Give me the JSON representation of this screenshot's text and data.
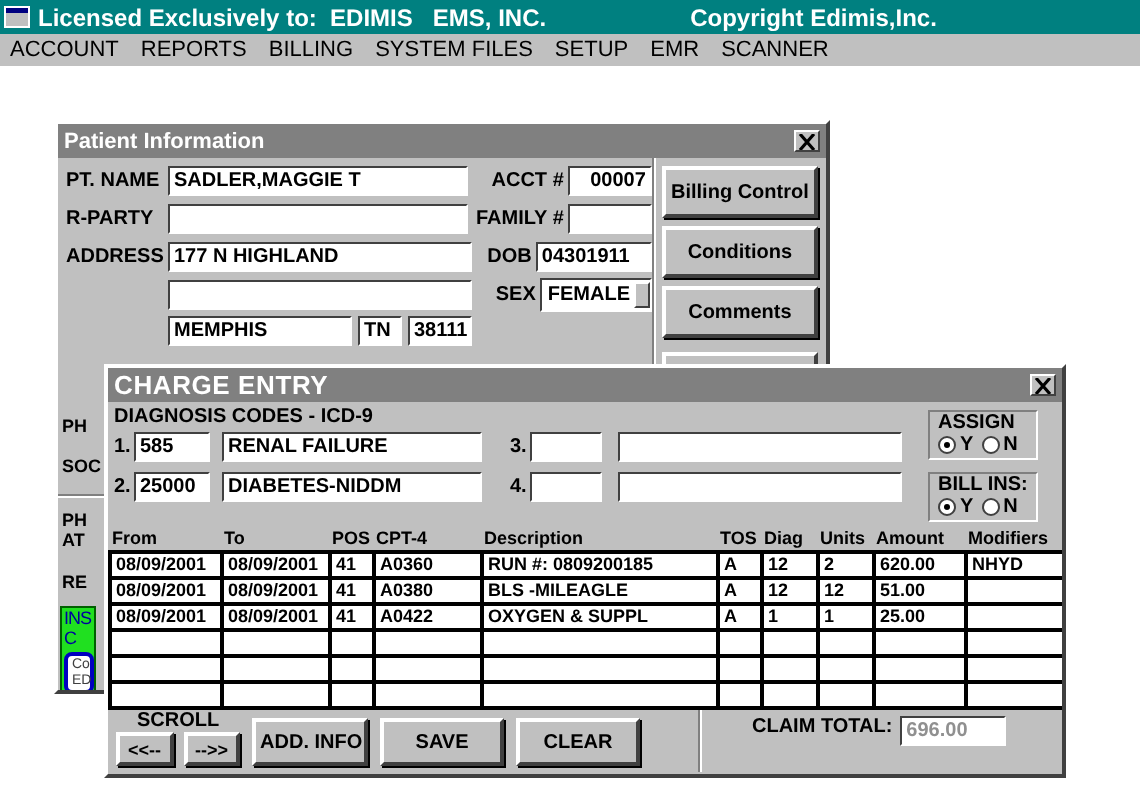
{
  "app_bar": {
    "title": "Licensed Exclusively to:  EDIMIS   EMS, INC.",
    "copyright": "Copyright Edimis,Inc."
  },
  "menu": [
    {
      "label": "ACCOUNT"
    },
    {
      "label": "REPORTS"
    },
    {
      "label": "BILLING"
    },
    {
      "label": "SYSTEM FILES"
    },
    {
      "label": "SETUP"
    },
    {
      "label": "EMR"
    },
    {
      "label": "SCANNER"
    }
  ],
  "patient_window": {
    "title": "Patient Information",
    "pt_name": {
      "label": "PT. NAME",
      "value": "SADLER,MAGGIE T"
    },
    "acct": {
      "label": "ACCT #",
      "value": "00007"
    },
    "r_party": {
      "label": "R-PARTY"
    },
    "family": {
      "label": "FAMILY #"
    },
    "address": {
      "label": "ADDRESS",
      "line1": "177 N HIGHLAND",
      "city": "MEMPHIS",
      "state": "TN",
      "zip": "38111"
    },
    "dob": {
      "label": "DOB",
      "value": "04301911"
    },
    "sex": {
      "label": "SEX",
      "value": "FEMALE"
    },
    "side_labels": [
      "PH",
      "SOC",
      "PH",
      "AT",
      "RE"
    ],
    "insurance_box": {
      "lines": [
        "INS",
        "C"
      ],
      "card_lines": [
        "Co",
        "ED"
      ]
    },
    "buttons": [
      "Billing Control",
      "Conditions",
      "Comments"
    ]
  },
  "charge_window": {
    "title": "CHARGE ENTRY",
    "diagnosis_label": "DIAGNOSIS CODES - ICD-9",
    "diagnoses": [
      {
        "number": "1.",
        "code": "585",
        "description": "RENAL FAILURE"
      },
      {
        "number": "3."
      },
      {
        "number": "2.",
        "code": "25000",
        "description": "DIABETES-NIDDM"
      },
      {
        "number": "4."
      }
    ],
    "assign": {
      "label": "ASSIGN",
      "options": [
        {
          "label": "Y",
          "selected": true
        },
        {
          "label": "N",
          "selected": false
        }
      ]
    },
    "bill_ins": {
      "label": "BILL INS:",
      "options": [
        {
          "label": "Y",
          "selected": true
        },
        {
          "label": "N",
          "selected": false
        }
      ]
    },
    "table": {
      "columns": [
        "From",
        "To",
        "POS",
        "CPT-4",
        "Description",
        "TOS",
        "Diag",
        "Units",
        "Amount",
        "Modifiers"
      ],
      "rows": [
        [
          "08/09/2001",
          "08/09/2001",
          "41",
          "A0360",
          "RUN #: 0809200185",
          "A",
          "12",
          "2",
          "620.00",
          "NHYD"
        ],
        [
          "08/09/2001",
          "08/09/2001",
          "41",
          "A0380",
          "BLS -MILEAGLE",
          "A",
          "12",
          "12",
          "51.00",
          ""
        ],
        [
          "08/09/2001",
          "08/09/2001",
          "41",
          "A0422",
          "OXYGEN & SUPPL",
          "A",
          "1",
          "1",
          "25.00",
          ""
        ],
        [
          "",
          "",
          "",
          "",
          "",
          "",
          "",
          "",
          "",
          ""
        ],
        [
          "",
          "",
          "",
          "",
          "",
          "",
          "",
          "",
          "",
          ""
        ],
        [
          "",
          "",
          "",
          "",
          "",
          "",
          "",
          "",
          "",
          ""
        ]
      ]
    },
    "scroll": {
      "label": "SCROLL",
      "back": "<<--",
      "forward": "-->>"
    },
    "buttons": [
      "ADD. INFO",
      "SAVE",
      "CLEAR"
    ],
    "claim_total": {
      "label": "CLAIM TOTAL:",
      "value": "696.00",
      "disabled": true
    }
  }
}
